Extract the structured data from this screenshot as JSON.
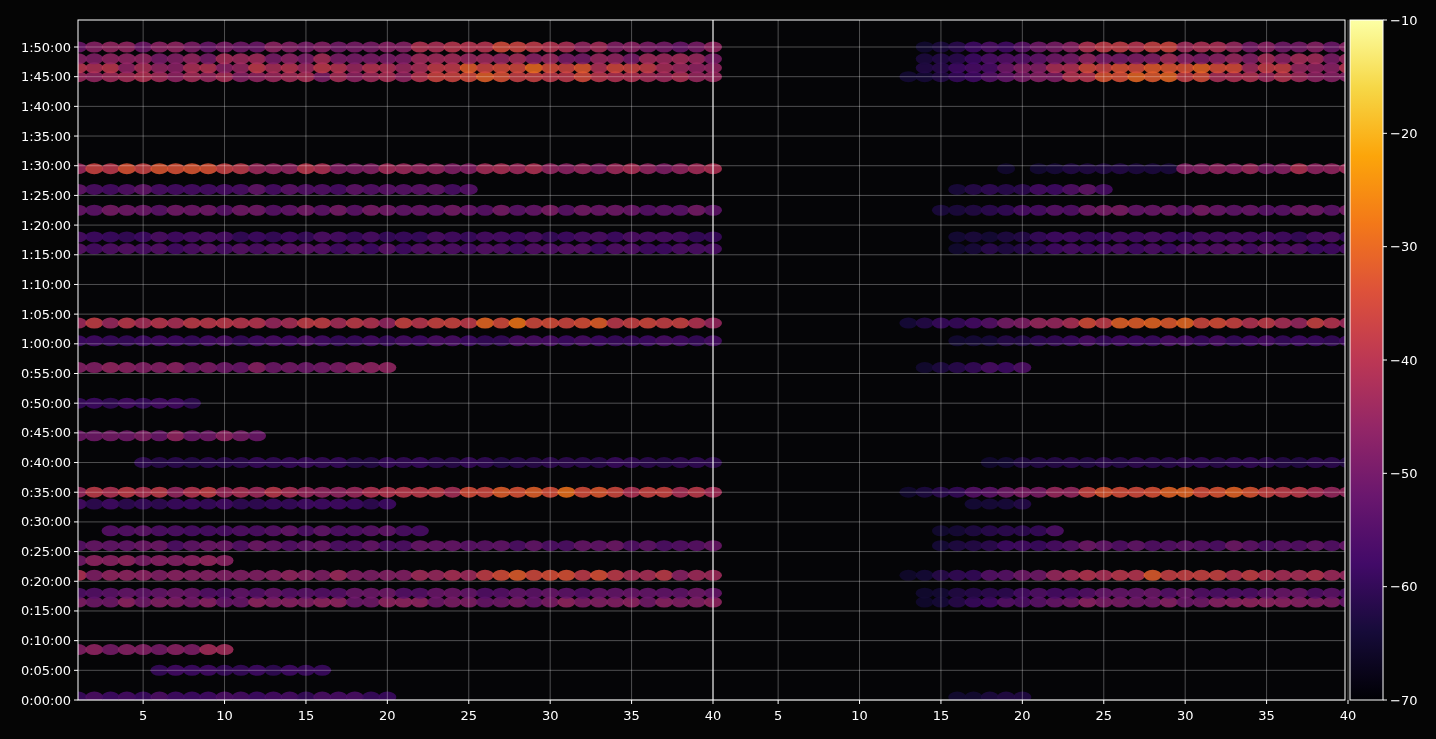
{
  "y_axis": {
    "ticks": [
      "1:50:00",
      "1:45:00",
      "1:40:00",
      "1:35:00",
      "1:30:00",
      "1:25:00",
      "1:20:00",
      "1:15:00",
      "1:10:00",
      "1:05:00",
      "1:00:00",
      "0:55:00",
      "0:50:00",
      "0:45:00",
      "0:40:00",
      "0:35:00",
      "0:30:00",
      "0:25:00",
      "0:20:00",
      "0:15:00",
      "0:10:00",
      "0:05:00",
      "0:00:00"
    ]
  },
  "x_axis_left": {
    "ticks": [
      "5",
      "10",
      "15",
      "20",
      "25",
      "30",
      "35",
      "40"
    ]
  },
  "x_axis_right": {
    "ticks": [
      "5",
      "10",
      "15",
      "20",
      "25",
      "30",
      "35",
      "40"
    ]
  },
  "colorbar": {
    "ticks": [
      "−10",
      "−20",
      "−30",
      "−40",
      "−50",
      "−60",
      "−70"
    ]
  }
}
